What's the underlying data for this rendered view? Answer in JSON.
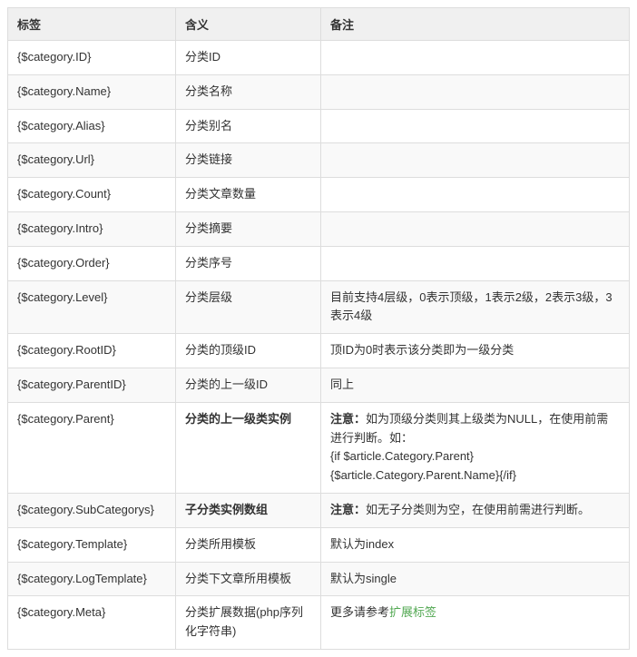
{
  "headers": {
    "tag": "标签",
    "meaning": "含义",
    "note": "备注"
  },
  "rows": [
    {
      "tag": "{$category.ID}",
      "meaning": "分类ID",
      "meaning_bold": false,
      "note": "",
      "note_bold_prefix": "",
      "note_rest": "",
      "note_link": ""
    },
    {
      "tag": "{$category.Name}",
      "meaning": "分类名称",
      "meaning_bold": false,
      "note": "",
      "note_bold_prefix": "",
      "note_rest": "",
      "note_link": ""
    },
    {
      "tag": "{$category.Alias}",
      "meaning": "分类别名",
      "meaning_bold": false,
      "note": "",
      "note_bold_prefix": "",
      "note_rest": "",
      "note_link": ""
    },
    {
      "tag": "{$category.Url}",
      "meaning": "分类链接",
      "meaning_bold": false,
      "note": "",
      "note_bold_prefix": "",
      "note_rest": "",
      "note_link": ""
    },
    {
      "tag": "{$category.Count}",
      "meaning": "分类文章数量",
      "meaning_bold": false,
      "note": "",
      "note_bold_prefix": "",
      "note_rest": "",
      "note_link": ""
    },
    {
      "tag": "{$category.Intro}",
      "meaning": "分类摘要",
      "meaning_bold": false,
      "note": "",
      "note_bold_prefix": "",
      "note_rest": "",
      "note_link": ""
    },
    {
      "tag": "{$category.Order}",
      "meaning": "分类序号",
      "meaning_bold": false,
      "note": "",
      "note_bold_prefix": "",
      "note_rest": "",
      "note_link": ""
    },
    {
      "tag": "{$category.Level}",
      "meaning": "分类层级",
      "meaning_bold": false,
      "note": "目前支持4层级，0表示顶级，1表示2级，2表示3级，3表示4级",
      "note_bold_prefix": "",
      "note_rest": "",
      "note_link": ""
    },
    {
      "tag": "{$category.RootID}",
      "meaning": "分类的顶级ID",
      "meaning_bold": false,
      "note": "顶ID为0时表示该分类即为一级分类",
      "note_bold_prefix": "",
      "note_rest": "",
      "note_link": ""
    },
    {
      "tag": "{$category.ParentID}",
      "meaning": "分类的上一级ID",
      "meaning_bold": false,
      "note": "同上",
      "note_bold_prefix": "",
      "note_rest": "",
      "note_link": ""
    },
    {
      "tag": "{$category.Parent}",
      "meaning": "分类的上一级类实例",
      "meaning_bold": true,
      "note": "",
      "note_bold_prefix": "注意：",
      "note_rest": "如为顶级分类则其上级类为NULL，在使用前需进行判断。如：\n{if $article.Category.Parent}{$article.Category.Parent.Name}{/if}",
      "note_link": ""
    },
    {
      "tag": "{$category.SubCategorys}",
      "meaning": "子分类实例数组",
      "meaning_bold": true,
      "note": "",
      "note_bold_prefix": "注意：",
      "note_rest": "如无子分类则为空，在使用前需进行判断。",
      "note_link": ""
    },
    {
      "tag": "{$category.Template}",
      "meaning": "分类所用模板",
      "meaning_bold": false,
      "note": "默认为index",
      "note_bold_prefix": "",
      "note_rest": "",
      "note_link": ""
    },
    {
      "tag": "{$category.LogTemplate}",
      "meaning": "分类下文章所用模板",
      "meaning_bold": false,
      "note": "默认为single",
      "note_bold_prefix": "",
      "note_rest": "",
      "note_link": ""
    },
    {
      "tag": "{$category.Meta}",
      "meaning": "分类扩展数据(php序列化字符串)",
      "meaning_bold": false,
      "note": "更多请参考",
      "note_bold_prefix": "",
      "note_rest": "",
      "note_link": "扩展标签"
    }
  ]
}
